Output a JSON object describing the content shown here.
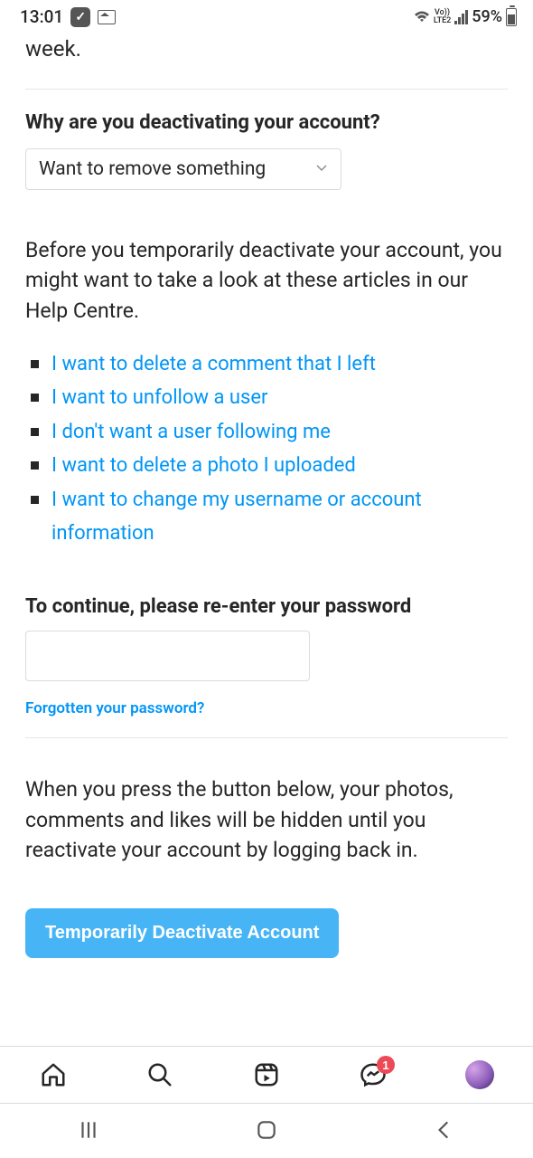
{
  "status": {
    "time": "13:01",
    "battery": "59%",
    "network": "LTE2",
    "volte": "Vo))"
  },
  "truncated": "week.",
  "reason": {
    "title": "Why are you deactivating your account?",
    "selected": "Want to remove something"
  },
  "help": {
    "intro": "Before you temporarily deactivate your account, you might want to take a look at these articles in our Help Centre.",
    "links": [
      "I want to delete a comment that I left",
      "I want to unfollow a user",
      "I don't want a user following me",
      "I want to delete a photo I uploaded",
      "I want to change my username or account information"
    ]
  },
  "password": {
    "label": "To continue, please re-enter your password",
    "forgot": "Forgotten your password?"
  },
  "final": {
    "text": "When you press the button below, your photos, comments and likes will be hidden until you reactivate your account by logging back in.",
    "button": "Temporarily Deactivate Account"
  },
  "nav": {
    "messages_badge": "1"
  }
}
